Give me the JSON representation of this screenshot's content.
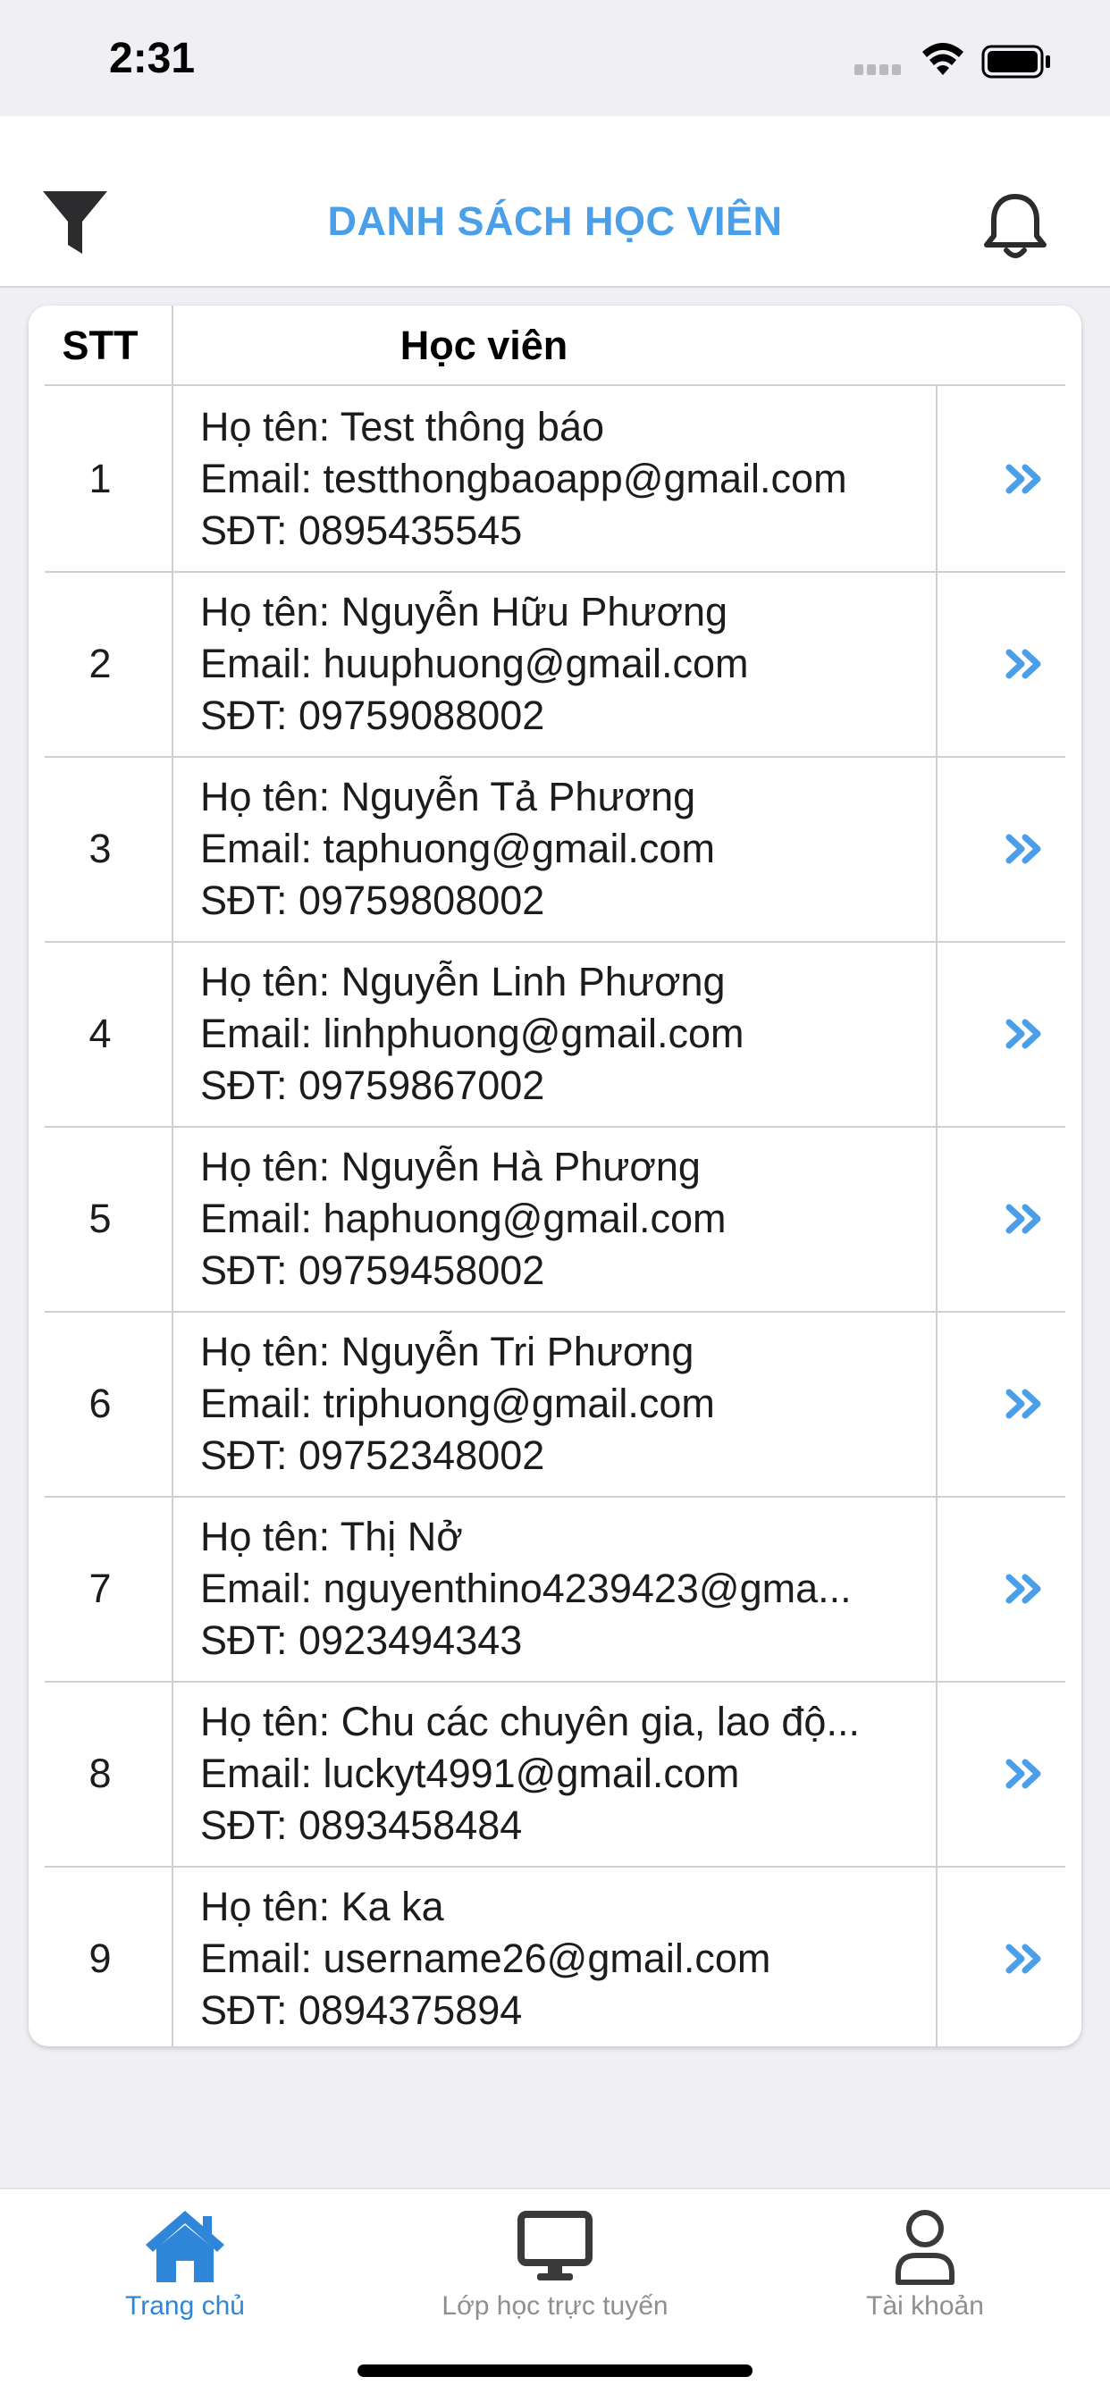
{
  "status_bar": {
    "time": "2:31"
  },
  "header": {
    "title": "DANH SÁCH HỌC VIÊN"
  },
  "table": {
    "columns": [
      "STT",
      "Học viên"
    ],
    "rows": [
      {
        "stt": "1",
        "name": "Họ tên: Test thông báo",
        "email": "Email: testthongbaoapp@gmail.com",
        "phone": "SĐT: 0895435545"
      },
      {
        "stt": "2",
        "name": "Họ tên: Nguyễn Hữu Phương",
        "email": "Email: huuphuong@gmail.com",
        "phone": "SĐT: 09759088002"
      },
      {
        "stt": "3",
        "name": "Họ tên: Nguyễn Tả Phương",
        "email": "Email: taphuong@gmail.com",
        "phone": "SĐT: 09759808002"
      },
      {
        "stt": "4",
        "name": "Họ tên: Nguyễn Linh Phương",
        "email": "Email: linhphuong@gmail.com",
        "phone": "SĐT: 09759867002"
      },
      {
        "stt": "5",
        "name": "Họ tên: Nguyễn Hà Phương",
        "email": "Email: haphuong@gmail.com",
        "phone": "SĐT: 09759458002"
      },
      {
        "stt": "6",
        "name": "Họ tên: Nguyễn Tri Phương",
        "email": "Email: triphuong@gmail.com",
        "phone": "SĐT: 09752348002"
      },
      {
        "stt": "7",
        "name": "Họ tên: Thị Nở",
        "email": "Email: nguyenthino4239423@gma...",
        "phone": "SĐT: 0923494343"
      },
      {
        "stt": "8",
        "name": "Họ tên: Chu các chuyên gia, lao độ...",
        "email": "Email: luckyt4991@gmail.com",
        "phone": "SĐT: 0893458484"
      },
      {
        "stt": "9",
        "name": "Họ tên: Ka ka",
        "email": "Email: username26@gmail.com",
        "phone": "SĐT: 0894375894"
      }
    ]
  },
  "tabbar": {
    "tabs": [
      {
        "label": "Trang chủ",
        "icon": "home-icon",
        "active": true
      },
      {
        "label": "Lớp học trực tuyến",
        "icon": "monitor-icon",
        "active": false
      },
      {
        "label": "Tài khoản",
        "icon": "user-icon",
        "active": false
      }
    ]
  },
  "colors": {
    "accent": "#4a9fe8",
    "tab_active": "#2f86d8",
    "tab_inactive": "#8e8e93",
    "icon_dark": "#3a3a3c"
  }
}
